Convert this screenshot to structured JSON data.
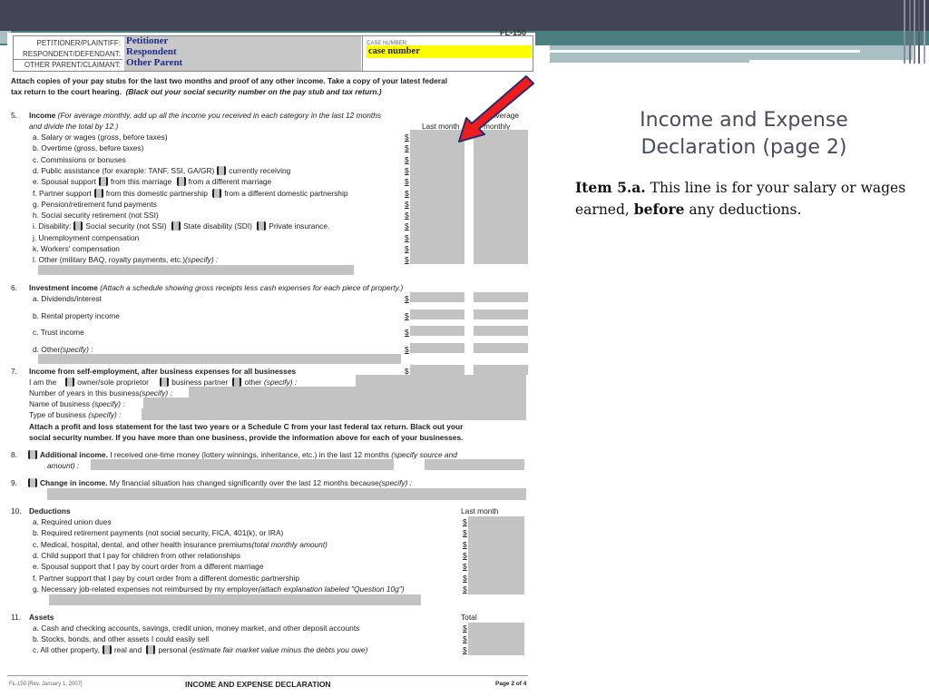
{
  "slide": {
    "title": "Income and Expense Declaration (page 2)",
    "body_lead": "Item 5.a.",
    "body_text_1": " This line is for your salary or wages earned, ",
    "body_bold": "before",
    "body_text_2": " any deductions."
  },
  "form": {
    "code": "FL-150",
    "header": {
      "petitioner_label": "PETITIONER/PLAINTIFF:",
      "petitioner_value": "Petitioner",
      "respondent_label": "RESPONDENT/DEFENDANT:",
      "respondent_value": "Respondent",
      "other_label": "OTHER PARENT/CLAIMANT:",
      "other_value": "Other Parent",
      "case_number_label": "CASE NUMBER:",
      "case_number_value": "case number"
    },
    "intro_line_1": "Attach copies of your pay stubs for the last two months and proof of any other income. Take a copy of your latest federal",
    "intro_line_2a": "tax return to the court hearing.",
    "intro_line_2b": "(Black out your social security number on the pay stub and tax return.)",
    "s5": {
      "num": "5.",
      "title": "Income",
      "desc_1": "(For average monthly, add up all the income you received in each category in the last 12 months",
      "desc_2": "and divide the total by 12.)",
      "col_last_month": "Last month",
      "col_average": "Average",
      "col_monthly": "monthly",
      "items": [
        "a.  Salary or wages (gross, before taxes)",
        "b.  Overtime (gross, before taxes)",
        "c.  Commissions or bonuses",
        "d.  Public assistance (for example: TANF, SSI, GA/GR)",
        "e.  Spousal support",
        "f.  Partner support",
        "g.  Pension/retirement fund payments",
        "h.  Social security retirement (not SSI)",
        "i.  Disability:",
        "j.  Unemployment compensation",
        "k.  Workers' compensation",
        "l.  Other (military BAQ, royalty payments, etc.)"
      ],
      "d_opt": "currently receiving",
      "e_opt1": "from this marriage",
      "e_opt2": "from a different marriage",
      "f_opt1": "from this domestic partnership",
      "f_opt2": "from a different domestic partnership",
      "i_opt1": "Social security (not SSI)",
      "i_opt2": "State disability (SDI)",
      "i_opt3": "Private insurance.",
      "specify": "(specify) :",
      "dollar": "$"
    },
    "s6": {
      "num": "6.",
      "title": "Investment income",
      "desc": "(Attach a schedule showing gross receipts less cash expenses for each piece of property.)",
      "items": [
        "a.  Dividends/interest",
        "b.  Rental property income",
        "c.  Trust income",
        "d.  Other"
      ],
      "specify": "(specify) :"
    },
    "s7": {
      "num": "7.",
      "title": "Income from self-employment, after business expenses for all businesses",
      "iam": "I am the",
      "opt1": "owner/sole proprietor",
      "opt2": "business partner",
      "opt3": "other",
      "specify": "(specify) :",
      "years": "Number of years in this business",
      "name": "Name of business",
      "type": "Type of business",
      "attach_1": "Attach a profit and loss statement for the last two years or a Schedule C from your last federal tax return. Black out your",
      "attach_2": "social security number. If you have more than one business, provide the information above for each of your businesses."
    },
    "s8": {
      "num": "8.",
      "title": "Additional income.",
      "text": " I received one-time money (lottery winnings, inheritance, etc.) in the last 12 months",
      "specify_1": "(specify source and",
      "specify_2": "amount) :"
    },
    "s9": {
      "num": "9.",
      "title": "Change in income.",
      "text": " My financial situation has changed significantly over the last 12 months because",
      "specify": "(specify) :"
    },
    "s10": {
      "num": "10.",
      "title": "Deductions",
      "col": "Last month",
      "items": [
        "a.  Required union dues",
        "b.  Required retirement payments (not social security, FICA, 401(k), or IRA)",
        "c.  Medical, hospital, dental, and other health insurance premiums",
        "d.  Child support that I pay for children from other relationships",
        "e.  Spousal support that I pay by court order from a different marriage",
        "f.  Partner support that I pay by court order from a different domestic partnership",
        "g.  Necessary job-related expenses not reimbursed by my employer"
      ],
      "c_note": "(total monthly amount)",
      "g_note": "(attach explanation labeled \"Question 10g\")"
    },
    "s11": {
      "num": "11.",
      "title": "Assets",
      "col": "Total",
      "items": [
        "a.  Cash and checking accounts, savings, credit union, money market, and other deposit accounts",
        "b.  Stocks, bonds, and other assets I could easily sell",
        "c.  All other property,"
      ],
      "c_opt1": "real and",
      "c_opt2": "personal",
      "c_note": "(estimate fair market value minus the debts you owe)"
    },
    "footer": {
      "rev": "FL-150 [Rev. January 1, 2007]",
      "title": "INCOME AND EXPENSE DECLARATION",
      "page": "Page 2 of 4"
    }
  }
}
